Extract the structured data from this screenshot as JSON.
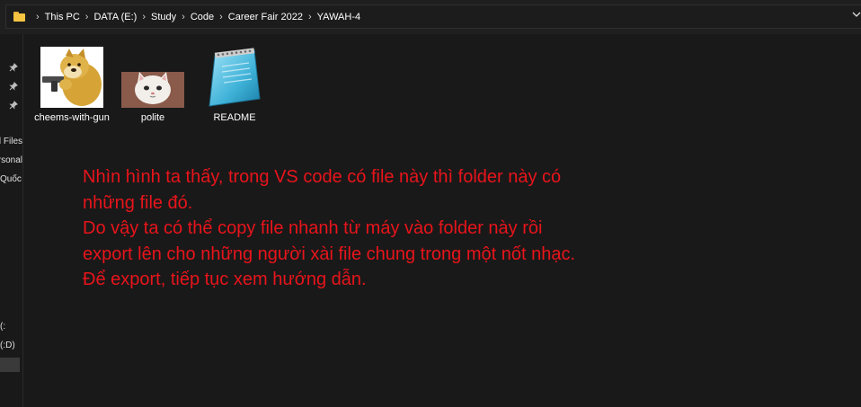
{
  "address_bar": {
    "breadcrumbs": [
      "This PC",
      "DATA (E:)",
      "Study",
      "Code",
      "Career Fair 2022",
      "YAWAH-4"
    ],
    "separator": "›",
    "dropdown_icon": "chevron-down-icon"
  },
  "sidebar": {
    "pins": [
      "pin-icon",
      "pin-icon",
      "pin-icon"
    ],
    "items": [
      "d Files",
      "rsonal",
      "Quốc",
      ":)",
      "(D:)"
    ]
  },
  "files": [
    {
      "name": "cheems-with-gun",
      "thumbnail": "cheems-dog-image"
    },
    {
      "name": "polite",
      "thumbnail": "polite-cat-image"
    },
    {
      "name": "README",
      "thumbnail": "notepad-icon"
    }
  ],
  "annotation": {
    "lines": [
      "Nhìn hình ta thấy, trong VS code có file này thì folder này có",
      "những file đó.",
      "Do vậy ta có thể copy file nhanh từ máy vào folder này rồi",
      "export lên cho những người xài file chung trong một nốt nhạc.",
      "Để export, tiếp tục xem hướng dẫn."
    ],
    "color": "#e8141b"
  }
}
